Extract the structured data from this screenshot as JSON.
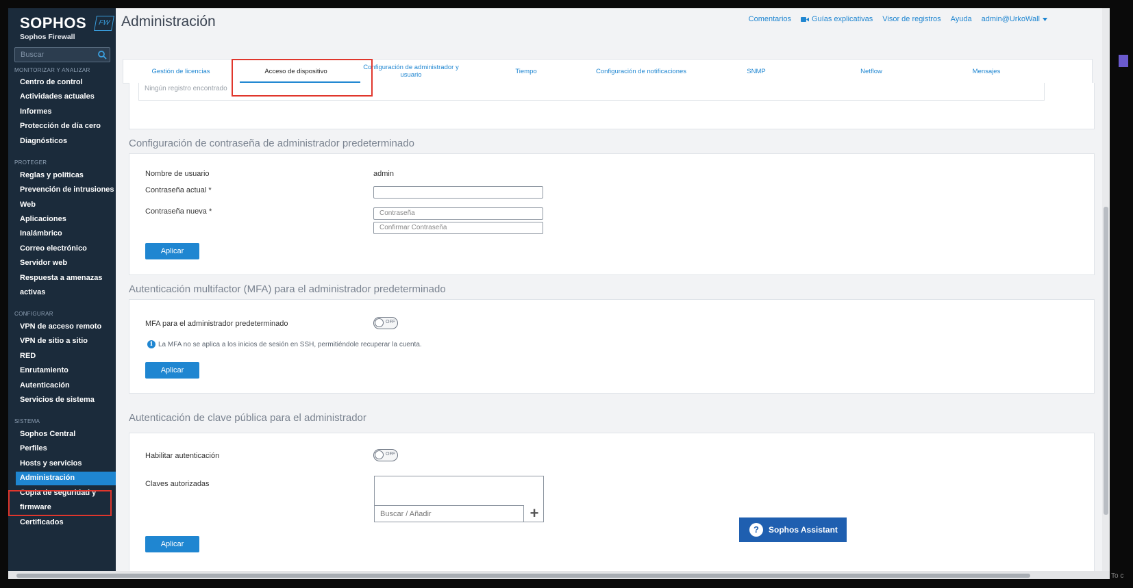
{
  "brand": {
    "name": "SOPHOS",
    "badge": "FW",
    "product": "Sophos Firewall"
  },
  "search": {
    "placeholder": "Buscar"
  },
  "sidebar": {
    "sections": [
      {
        "title": "MONITORIZAR Y ANALIZAR"
      },
      {
        "title": "PROTEGER"
      },
      {
        "title": "CONFIGURAR"
      },
      {
        "title": "SISTEMA"
      }
    ],
    "items": [
      "Centro de control",
      "Actividades actuales",
      "Informes",
      "Protección de día cero",
      "Diagnósticos",
      "Reglas y políticas",
      "Prevención de intrusiones",
      "Web",
      "Aplicaciones",
      "Inalámbrico",
      "Correo electrónico",
      "Servidor web",
      "Respuesta a amenazas",
      "activas",
      "VPN de acceso remoto",
      "VPN de sitio a sitio",
      "RED",
      "Enrutamiento",
      "Autenticación",
      "Servicios de sistema",
      "Sophos Central",
      "Perfiles",
      "Hosts y servicios",
      "Administración",
      "Copia de seguridad y",
      "firmware",
      "Certificados"
    ]
  },
  "header": {
    "title": "Administración",
    "links": {
      "feedback": "Comentarios",
      "guides": "Guías explicativas",
      "logs": "Visor de registros",
      "help": "Ayuda",
      "user": "admin@UrkoWall"
    }
  },
  "tabs": [
    "Gestión de licencias",
    "Acceso de dispositivo",
    "Configuración de administrador y usuario",
    "Tiempo",
    "Configuración de notificaciones",
    "SNMP",
    "Netflow",
    "Mensajes"
  ],
  "active_tab": "Acceso de dispositivo",
  "top_card": {
    "empty_text": "Ningún registro encontrado"
  },
  "password_section": {
    "heading": "Configuración de contraseña de administrador predeterminado",
    "username_label": "Nombre de usuario",
    "username_value": "admin",
    "current_label": "Contraseña actual *",
    "new_label": "Contraseña nueva *",
    "new_placeholder": "Contraseña",
    "confirm_placeholder": "Confirmar Contraseña",
    "apply": "Aplicar"
  },
  "mfa_section": {
    "heading": "Autenticación multifactor (MFA) para el administrador predeterminado",
    "label": "MFA para el administrador predeterminado",
    "toggle": "OFF",
    "note": "La MFA no se aplica a los inicios de sesión en SSH, permitiéndole recuperar la cuenta.",
    "apply": "Aplicar"
  },
  "pubkey_section": {
    "heading": "Autenticación de clave pública para el administrador",
    "enable_label": "Habilitar autenticación",
    "toggle": "OFF",
    "keys_label": "Claves autorizadas",
    "keys_placeholder": "Buscar / Añadir",
    "apply": "Aplicar"
  },
  "assistant": {
    "label": "Sophos Assistant"
  },
  "corner_text": "To c",
  "colors": {
    "sidebar": "#1b2b3b",
    "accent": "#1f86d1",
    "highlight": "#e0362c"
  }
}
